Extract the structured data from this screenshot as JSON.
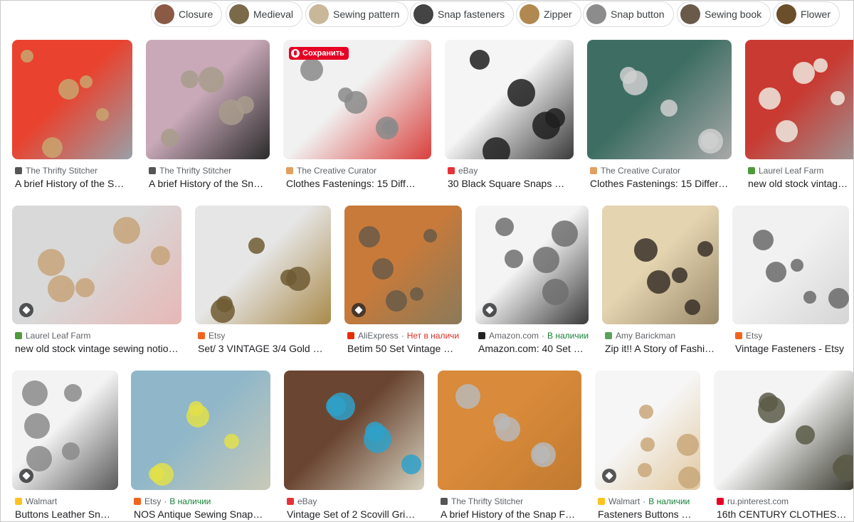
{
  "chips": [
    {
      "label": "Closure",
      "color": "#8a5a44"
    },
    {
      "label": "Medieval",
      "color": "#7a6a4a"
    },
    {
      "label": "Sewing pattern",
      "color": "#c9b79a"
    },
    {
      "label": "Snap fasteners",
      "color": "#444444"
    },
    {
      "label": "Zipper",
      "color": "#b08850"
    },
    {
      "label": "Snap button",
      "color": "#8c8c8c"
    },
    {
      "label": "Sewing book",
      "color": "#6a5a4a"
    },
    {
      "label": "Flower",
      "color": "#6b4e2a"
    }
  ],
  "save_pin_label": "Сохранить",
  "results": [
    {
      "source": "The Thrifty Stitcher",
      "favicon": "thrifty-stitcher-favicon",
      "title": "A brief History of the Sn…",
      "stock": "",
      "colors": [
        "#e9422e",
        "#c9a46e",
        "#9aa0a8"
      ]
    },
    {
      "source": "The Thrifty Stitcher",
      "favicon": "thrifty-stitcher-favicon",
      "title": "A brief History of the Sna…",
      "stock": "",
      "colors": [
        "#c9a9b8",
        "#a89c8c",
        "#2b2b2b"
      ]
    },
    {
      "source": "The Creative Curator",
      "favicon": "creative-curator-favicon",
      "title": "Clothes Fastenings: 15 Differe…",
      "stock": "",
      "colors": [
        "#f1f1f1",
        "#8a8a8a",
        "#d8403d"
      ]
    },
    {
      "source": "eBay",
      "favicon": "ebay-favicon",
      "title": "30 Black Square Snaps fa…",
      "stock": "",
      "colors": [
        "#f5f5f5",
        "#1f1f1f",
        "#3a3a3a"
      ]
    },
    {
      "source": "The Creative Curator",
      "favicon": "creative-curator-favicon",
      "title": "Clothes Fastenings: 15 Differe…",
      "stock": "",
      "colors": [
        "#3e6e63",
        "#cfcfcf",
        "#a9a9a9"
      ]
    },
    {
      "source": "Laurel Leaf Farm",
      "favicon": "laurel-leaf-favicon",
      "title": "new old stock vintage sewi…",
      "stock": "",
      "colors": [
        "#c93a32",
        "#efe9df",
        "#9a9a9a"
      ]
    },
    {
      "source": "Laurel Leaf Farm",
      "favicon": "laurel-leaf-favicon",
      "title": "new old stock vintage sewing notion…",
      "stock": "",
      "colors": [
        "#d9d9d9",
        "#c7a37a",
        "#e6b7b5"
      ]
    },
    {
      "source": "Etsy",
      "favicon": "etsy-favicon",
      "title": "Set/ 3 VINTAGE 3/4 Gold M…",
      "stock": "",
      "colors": [
        "#e6e6e6",
        "#6f5a33",
        "#a98a4a"
      ]
    },
    {
      "source": "AliExpress",
      "favicon": "aliexpress-favicon",
      "title": "Betim 50 Set Vintage M…",
      "stock": "Нет в наличи",
      "stock_kind": "out",
      "colors": [
        "#c87a3a",
        "#6a5a48",
        "#8a7a5a"
      ]
    },
    {
      "source": "Amazon.com",
      "favicon": "amazon-favicon",
      "title": "Amazon.com: 40 Set V…",
      "stock": "В наличии",
      "stock_kind": "in",
      "colors": [
        "#f4f4f4",
        "#6f6f6f",
        "#3a3a3a"
      ]
    },
    {
      "source": "Amy Barickman",
      "favicon": "amy-barickman-favicon",
      "title": "Zip it!! A Story of Fashio…",
      "stock": "",
      "colors": [
        "#e4d4b0",
        "#3a3028",
        "#9a8a6a"
      ]
    },
    {
      "source": "Etsy",
      "favicon": "etsy-favicon",
      "title": "Vintage Fasteners - Etsy",
      "stock": "",
      "colors": [
        "#f1f1f1",
        "#6a6a6a",
        "#d5d5d5"
      ]
    },
    {
      "source": "Walmart",
      "favicon": "walmart-favicon",
      "title": "Buttons Leather Sna…",
      "stock": "",
      "colors": [
        "#f3f3f3",
        "#8a8a8a",
        "#5a5a5a"
      ]
    },
    {
      "source": "Etsy",
      "favicon": "etsy-favicon",
      "title": "NOS Antique Sewing Snaps …",
      "stock": "В наличии",
      "stock_kind": "in",
      "colors": [
        "#8fb7c9",
        "#e2e04a",
        "#c9c9b8"
      ]
    },
    {
      "source": "eBay",
      "favicon": "ebay-favicon",
      "title": "Vintage Set of 2 Scovill Gripp…",
      "stock": "",
      "colors": [
        "#6a4632",
        "#2fa1c9",
        "#d7d2c0"
      ]
    },
    {
      "source": "The Thrifty Stitcher",
      "favicon": "thrifty-stitcher-favicon",
      "title": "A brief History of the Snap Fa…",
      "stock": "",
      "colors": [
        "#d98a3a",
        "#b9b9b9",
        "#c07a30"
      ]
    },
    {
      "source": "Walmart",
      "favicon": "walmart-favicon",
      "title": "Fasteners Buttons S…",
      "stock": "В наличии",
      "stock_kind": "in",
      "colors": [
        "#f6f6f6",
        "#c9a77a",
        "#e2c9a0"
      ]
    },
    {
      "source": "ru.pinterest.com",
      "favicon": "pinterest-favicon",
      "title": "16th CENTURY CLOTHES F…",
      "stock": "",
      "colors": [
        "#f4f4f4",
        "#5a5a48",
        "#3a3a30"
      ]
    }
  ]
}
